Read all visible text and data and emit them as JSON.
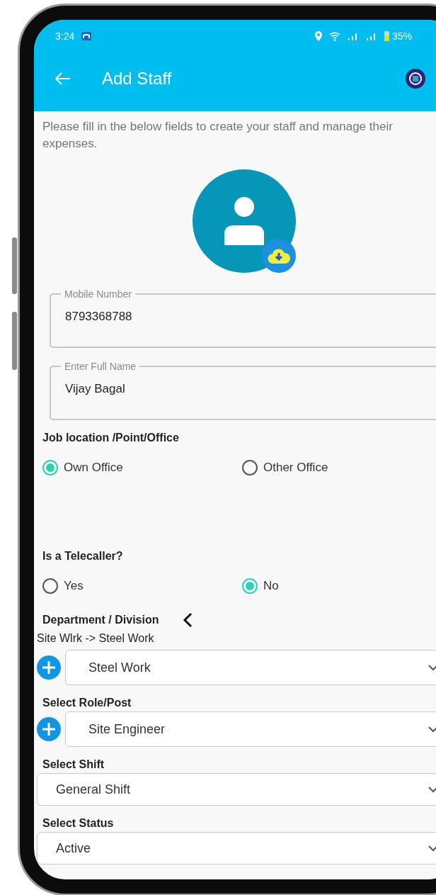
{
  "status_bar": {
    "time": "3:24",
    "battery": "35%"
  },
  "app_bar": {
    "title": "Add Staff"
  },
  "intro": "Please fill in the below fields to create your staff and manage their expenses.",
  "fields": [
    {
      "label": "Mobile Number",
      "value": "8793368788"
    },
    {
      "label": "Enter Full Name",
      "value": "Vijay Bagal"
    }
  ],
  "radio_groups": [
    {
      "title": "Job location /Point/Office",
      "options": [
        {
          "label": "Own Office",
          "selected": true
        },
        {
          "label": "Other Office",
          "selected": false
        }
      ]
    },
    {
      "title": "Is a Telecaller?",
      "options": [
        {
          "label": "Yes",
          "selected": false
        },
        {
          "label": "No",
          "selected": true
        }
      ]
    }
  ],
  "dropdowns": [
    {
      "kind": "with-add",
      "label": "Department / Division",
      "path": "Site Wlrk -> Steel Work",
      "value": "Steel Work"
    },
    {
      "kind": "with-add",
      "label": "Select Role/Post",
      "value": "Site Engineer"
    },
    {
      "kind": "plain",
      "label": "Select Shift",
      "value": "General Shift"
    },
    {
      "kind": "plain",
      "label": "Select Status",
      "value": "Active"
    }
  ]
}
